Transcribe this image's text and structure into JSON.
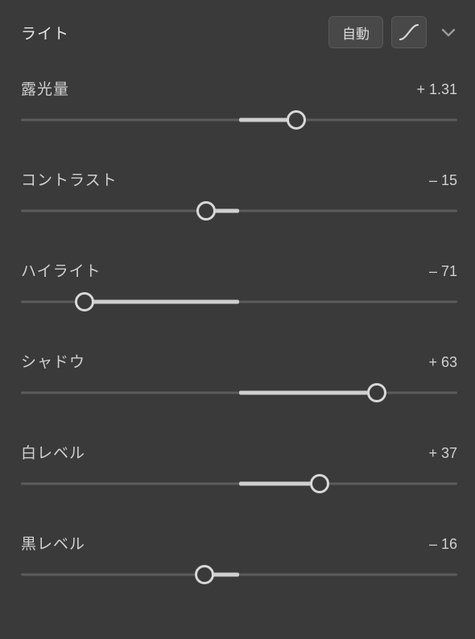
{
  "header": {
    "title": "ライト",
    "auto_label": "自動"
  },
  "sliders": [
    {
      "label": "露光量",
      "value_text": "+ 1.31",
      "min": -5,
      "max": 5,
      "center": 0,
      "value": 1.31
    },
    {
      "label": "コントラスト",
      "value_text": "– 15",
      "min": -100,
      "max": 100,
      "center": 0,
      "value": -15
    },
    {
      "label": "ハイライト",
      "value_text": "– 71",
      "min": -100,
      "max": 100,
      "center": 0,
      "value": -71
    },
    {
      "label": "シャドウ",
      "value_text": "+ 63",
      "min": -100,
      "max": 100,
      "center": 0,
      "value": 63
    },
    {
      "label": "白レベル",
      "value_text": "+ 37",
      "min": -100,
      "max": 100,
      "center": 0,
      "value": 37
    },
    {
      "label": "黒レベル",
      "value_text": "– 16",
      "min": -100,
      "max": 100,
      "center": 0,
      "value": -16
    }
  ]
}
